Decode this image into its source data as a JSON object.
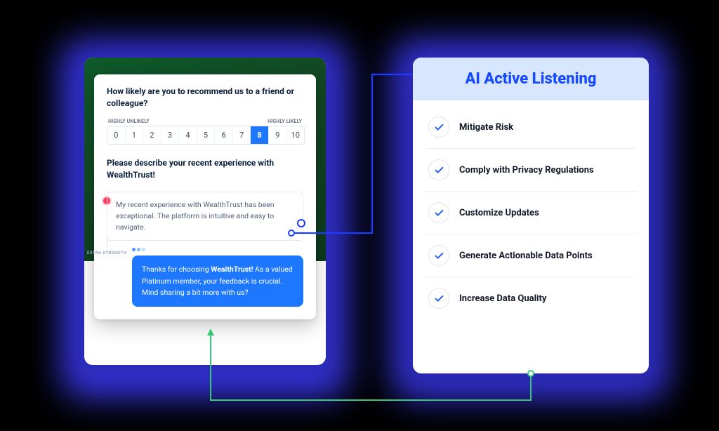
{
  "survey": {
    "q1": "How likely are you to recommend us to a friend or colleague?",
    "scale_low": "HIGHLY UNLIKELY",
    "scale_high": "HIGHLY LIKELY",
    "scale": [
      "0",
      "1",
      "2",
      "3",
      "4",
      "5",
      "6",
      "7",
      "8",
      "9",
      "10"
    ],
    "selected": "8",
    "q2": "Please describe your recent experience  with WealthTrust!",
    "response": "My recent experience with WealthTrust has been exceptional. The platform is intuitive and easy to navigate.",
    "extra_label": "EXTRA STRENGTH",
    "reply_prefix": "Thanks for choosing ",
    "reply_brand": "WealthTrust!",
    "reply_suffix": " As a valued Platinum member, your feedback is crucial. Mind sharing a bit more with us?"
  },
  "right": {
    "title": "AI Active Listening",
    "features": [
      "Mitigate Risk",
      "Comply with Privacy Regulations",
      "Customize Updates",
      "Generate Actionable Data Points",
      "Increase Data Quality"
    ]
  },
  "colors": {
    "accent": "#1e78ff",
    "brand_blue": "#1549ff",
    "glow": "#3d3cff",
    "green": "#0e5a2a",
    "check": "#1657ff"
  }
}
